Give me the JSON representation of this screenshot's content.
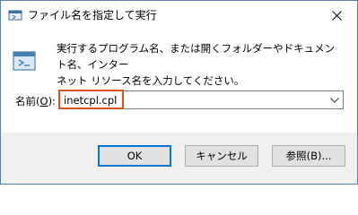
{
  "window": {
    "title": "ファイル名を指定して実行",
    "close_icon": "close-icon",
    "title_icon": "run-app-icon"
  },
  "content": {
    "description": "実行するプログラム名、または開くフォルダーやドキュメント名、インター\nネット リソース名を入力してください。",
    "name_label_text": "名前(",
    "name_label_key": "O",
    "name_label_end": "):",
    "input_value": "inetcpl.cpl",
    "dropdown_icon": "chevron-down-icon",
    "highlight_color": "#e0531a"
  },
  "buttons": {
    "ok": "OK",
    "cancel": "キャンセル",
    "browse": "参照(B)..."
  },
  "colors": {
    "accent": "#0078d7",
    "footer_bg": "#f0f0f0"
  }
}
